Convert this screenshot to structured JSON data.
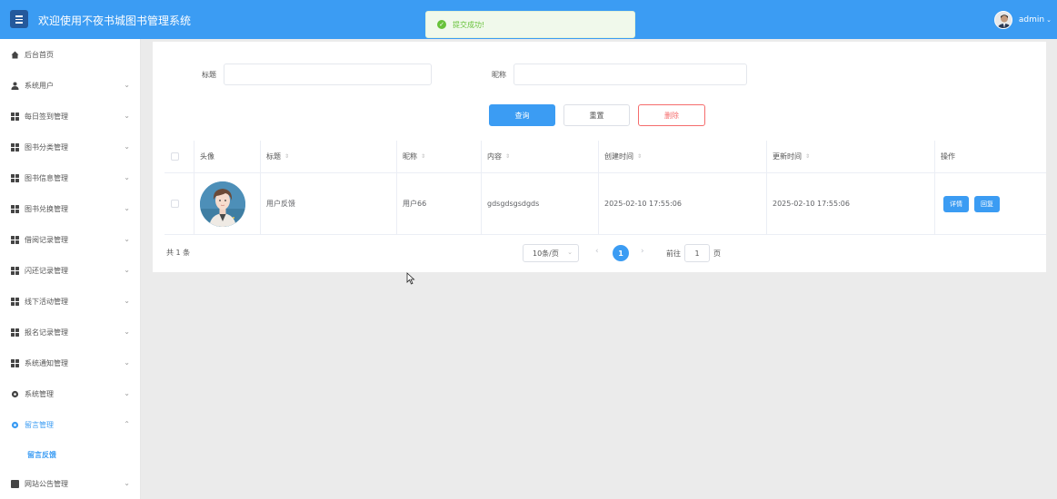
{
  "header": {
    "title": "欢迎使用不夜书城图书管理系统",
    "username": "admin",
    "caret": "⌄",
    "brand_color": "#3b9cf3"
  },
  "toast": {
    "text": "提交成功!",
    "icon": "check-circle-icon",
    "color": "#67c23a"
  },
  "sidebar": {
    "items": [
      {
        "label": "后台首页",
        "icon": "home-icon"
      },
      {
        "label": "系统用户",
        "icon": "user-icon"
      },
      {
        "label": "每日签到管理",
        "icon": "grid-icon"
      },
      {
        "label": "图书分类管理",
        "icon": "grid-icon"
      },
      {
        "label": "图书信息管理",
        "icon": "grid-icon"
      },
      {
        "label": "图书兑换管理",
        "icon": "grid-icon"
      },
      {
        "label": "借阅记录管理",
        "icon": "grid-icon"
      },
      {
        "label": "闪还记录管理",
        "icon": "grid-icon"
      },
      {
        "label": "线下活动管理",
        "icon": "grid-icon"
      },
      {
        "label": "报名记录管理",
        "icon": "grid-icon"
      },
      {
        "label": "系统通知管理",
        "icon": "grid-icon"
      },
      {
        "label": "系统管理",
        "icon": "gear-icon"
      },
      {
        "label": "留言管理",
        "icon": "gear-icon"
      },
      {
        "label": "网站公告管理",
        "icon": "doc-icon"
      }
    ],
    "active_sub": "留言反馈",
    "arrow_down": "⌄",
    "arrow_up": "⌃"
  },
  "search": {
    "title_label": "标题",
    "title_value": "",
    "nickname_label": "昵称",
    "nickname_value": "",
    "query_btn": "查询",
    "reset_btn": "重置",
    "delete_btn": "删除"
  },
  "table": {
    "columns": [
      "头像",
      "标题",
      "昵称",
      "内容",
      "创建时间",
      "更新时间",
      "操作"
    ],
    "sort_icon": "⇕",
    "rows": [
      {
        "avatar": "avatar-image",
        "title": "用户反馈",
        "nickname": "用户66",
        "content": "gdsgdsgsdgds",
        "created": "2025-02-10 17:55:06",
        "updated": "2025-02-10 17:55:06",
        "detail_btn": "详情",
        "reply_btn": "回复"
      }
    ]
  },
  "pagination": {
    "total": "共 1 条",
    "page_size": "10条/页",
    "prev": "‹",
    "next": "›",
    "current": "1",
    "goto_label": "前往",
    "goto_value": "1",
    "page_suffix": "页"
  }
}
